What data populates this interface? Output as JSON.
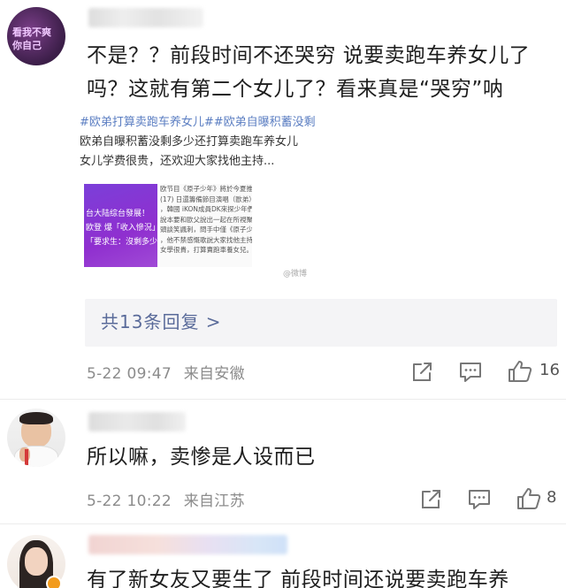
{
  "comments": [
    {
      "text": "不是？？前段时间不还哭穷 说要卖跑车养女儿了吗？这就有第二个女儿了？看来真是“哭穷”呐",
      "avatar_text_1": "看我不爽",
      "avatar_text_2": "你自己",
      "quote": {
        "line1": "#欧弟打算卖跑车养女儿##欧弟自曝积蓄没剩",
        "line2": "欧弟自曝积蓄没剩多少还打算卖跑车养女儿",
        "line3": "女儿学费很贵，还欢迎大家找他主持..."
      },
      "thumbnail": {
        "purple_lines": [
          "台大陆综台發展！",
          "欧登 爆「收入慘況」",
          "「要求生：沒剩多少了"
        ],
        "text_lines": [
          "欧节目《原子少年》將於今夏推出",
          "(17) 日還籌備節目演唱（歐弟）",
          "，韓國 iKON成員DK來探少年們",
          "說本要和歐父說出一起在所視聚",
          "頭談笑諷刺，問手中僅《原子少年》",
          "，他不禁感慨歌說大家找他主持，",
          "女學很貴，打算賣跑車養女兒。"
        ]
      },
      "watermark": "@微博",
      "replies_label": "共13条回复 >",
      "time": "5-22 09:47",
      "location": "来自安徽",
      "likes": "16"
    },
    {
      "text": "所以嘛，卖惨是人设而已",
      "time": "5-22 10:22",
      "location": "来自江苏",
      "likes": "8"
    },
    {
      "text": "有了新女友又要生了 前段时间还说要卖跑车养"
    }
  ],
  "icons": {
    "share": "share-icon",
    "comment": "comment-icon",
    "like": "like-icon"
  },
  "colors": {
    "link": "#5b7ec2",
    "replies_text": "#5a6b9a",
    "meta": "#8c8c8c"
  }
}
